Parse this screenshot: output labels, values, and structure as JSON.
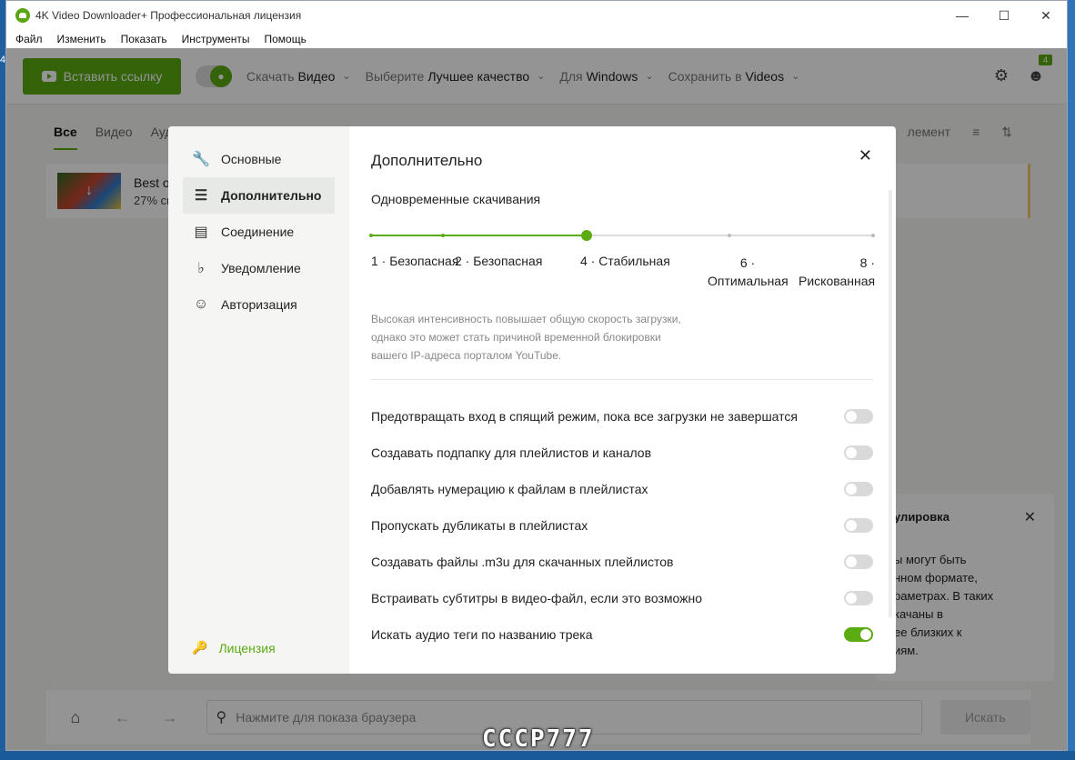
{
  "window": {
    "title": "4K Video Downloader+ Профессиональная лицензия",
    "menu": [
      "Файл",
      "Изменить",
      "Показать",
      "Инструменты",
      "Помощь"
    ]
  },
  "desktop": {
    "edge_text": "4"
  },
  "toolbar": {
    "paste_label": "Вставить ссылку",
    "download_prefix": "Скачать",
    "download_value": "Видео",
    "quality_prefix": "Выберите",
    "quality_value": "Лучшее качество",
    "os_prefix": "Для",
    "os_value": "Windows",
    "save_prefix": "Сохранить в",
    "save_value": "Videos",
    "badge_count": "4"
  },
  "tabs": [
    "Все",
    "Видео",
    "Ауд"
  ],
  "tabs_right": {
    "sort_partial": "лемент"
  },
  "download_item": {
    "title_partial": "Best of",
    "progress_partial": "27% ска"
  },
  "notice": {
    "title_partial": "улировка",
    "lines": [
      "ы могут быть",
      "нном формате,",
      "раметрах. В таких",
      "качаны в",
      "ее близких к",
      "иям."
    ]
  },
  "bottom": {
    "search_placeholder": "Нажмите для показа браузера",
    "search_button": "Искать"
  },
  "settings": {
    "sidebar": [
      {
        "label": "Основные",
        "icon": "wrench-icon"
      },
      {
        "label": "Дополнительно",
        "icon": "sliders-icon",
        "active": true
      },
      {
        "label": "Соединение",
        "icon": "server-icon"
      },
      {
        "label": "Уведомление",
        "icon": "bell-icon"
      },
      {
        "label": "Авторизация",
        "icon": "user-circle-icon"
      }
    ],
    "license_label": "Лицензия",
    "title": "Дополнительно",
    "concurrent_label": "Одновременные скачивания",
    "slider": {
      "value": 4,
      "min": 1,
      "max": 8,
      "ticks": [
        1,
        2,
        4,
        6,
        8
      ],
      "labels": [
        "1 · Безопасная",
        "2 · Безопасная",
        "4 · Стабильная",
        "6 ·",
        "Оптимальная",
        "8 ·",
        "Рискованная"
      ]
    },
    "hint_lines": [
      "Высокая интенсивность повышает общую скорость загрузки,",
      "однако это может стать причиной временной блокировки",
      "вашего IP-адреса порталом YouTube."
    ],
    "options": [
      {
        "label": "Предотвращать вход в спящий режим, пока все загрузки не завершатся",
        "on": false
      },
      {
        "label": "Создавать подпапку для плейлистов и каналов",
        "on": false
      },
      {
        "label": "Добавлять нумерацию к файлам в плейлистах",
        "on": false
      },
      {
        "label": "Пропускать дубликаты в плейлистах",
        "on": false
      },
      {
        "label": "Создавать файлы .m3u для скачанных плейлистов",
        "on": false
      },
      {
        "label": "Встраивать субтитры в видео-файл, если это возможно",
        "on": false
      },
      {
        "label": "Искать аудио теги по названию трека",
        "on": true
      }
    ]
  },
  "watermark": "CCCP777",
  "colors": {
    "accent": "#5bab12",
    "notice_border": "#f5c870"
  }
}
